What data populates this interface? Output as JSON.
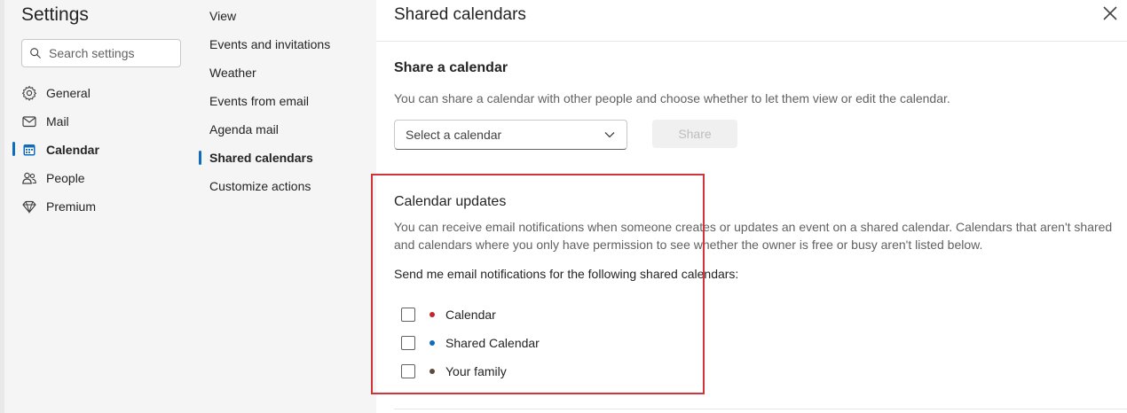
{
  "sidebar": {
    "title": "Settings",
    "search_placeholder": "Search settings",
    "items": [
      {
        "label": "General",
        "icon": "gear-icon"
      },
      {
        "label": "Mail",
        "icon": "mail-icon"
      },
      {
        "label": "Calendar",
        "icon": "calendar-icon",
        "active": true
      },
      {
        "label": "People",
        "icon": "people-icon"
      },
      {
        "label": "Premium",
        "icon": "diamond-icon"
      }
    ]
  },
  "subnav": {
    "items": [
      {
        "label": "View"
      },
      {
        "label": "Events and invitations"
      },
      {
        "label": "Weather"
      },
      {
        "label": "Events from email"
      },
      {
        "label": "Agenda mail"
      },
      {
        "label": "Shared calendars",
        "active": true
      },
      {
        "label": "Customize actions"
      }
    ]
  },
  "main": {
    "title": "Shared calendars",
    "share_section": {
      "title": "Share a calendar",
      "description": "You can share a calendar with other people and choose whether to let them view or edit the calendar.",
      "select_label": "Select a calendar",
      "share_button": "Share"
    },
    "updates_section": {
      "title": "Calendar updates",
      "description": "You can receive email notifications when someone creates or updates an event on a shared calendar. Calendars that aren't shared and calendars where you only have permission to see whether the owner is free or busy aren't listed below.",
      "send_label": "Send me email notifications for the following shared calendars:",
      "calendars": [
        {
          "name": "Calendar",
          "color": "#c4262e",
          "checked": false
        },
        {
          "name": "Shared Calendar",
          "color": "#0f6cbd",
          "checked": false
        },
        {
          "name": "Your family",
          "color": "#5c4b3c",
          "checked": false
        }
      ]
    }
  },
  "colors": {
    "accent": "#0f6cbd",
    "highlight": "#d13438"
  }
}
